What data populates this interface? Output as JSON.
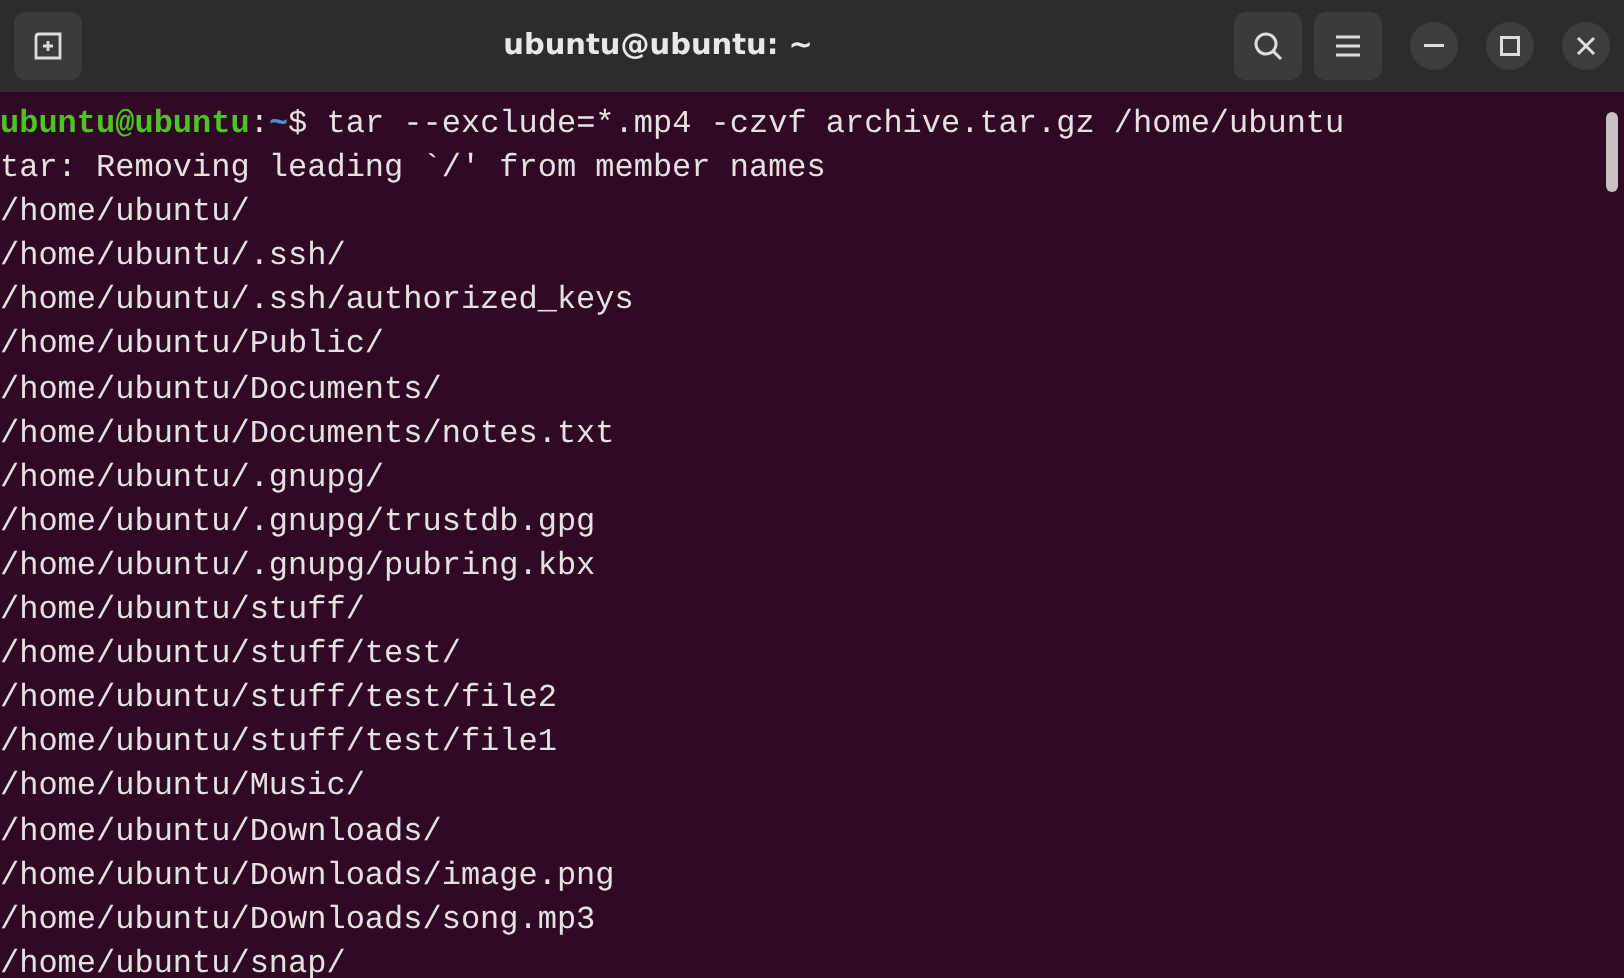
{
  "window": {
    "title": "ubuntu@ubuntu: ~"
  },
  "prompt": {
    "user_host": "ubuntu@ubuntu",
    "separator": ":",
    "path": "~",
    "symbol": "$",
    "command": " tar --exclude=*.mp4 -czvf archive.tar.gz /home/ubuntu"
  },
  "output": [
    "tar: Removing leading `/' from member names",
    "/home/ubuntu/",
    "/home/ubuntu/.ssh/",
    "/home/ubuntu/.ssh/authorized_keys",
    "/home/ubuntu/Public/",
    "/home/ubuntu/Documents/",
    "/home/ubuntu/Documents/notes.txt",
    "/home/ubuntu/.gnupg/",
    "/home/ubuntu/.gnupg/trustdb.gpg",
    "/home/ubuntu/.gnupg/pubring.kbx",
    "/home/ubuntu/stuff/",
    "/home/ubuntu/stuff/test/",
    "/home/ubuntu/stuff/test/file2",
    "/home/ubuntu/stuff/test/file1",
    "/home/ubuntu/Music/",
    "/home/ubuntu/Downloads/",
    "/home/ubuntu/Downloads/image.png",
    "/home/ubuntu/Downloads/song.mp3",
    "/home/ubuntu/snap/"
  ]
}
